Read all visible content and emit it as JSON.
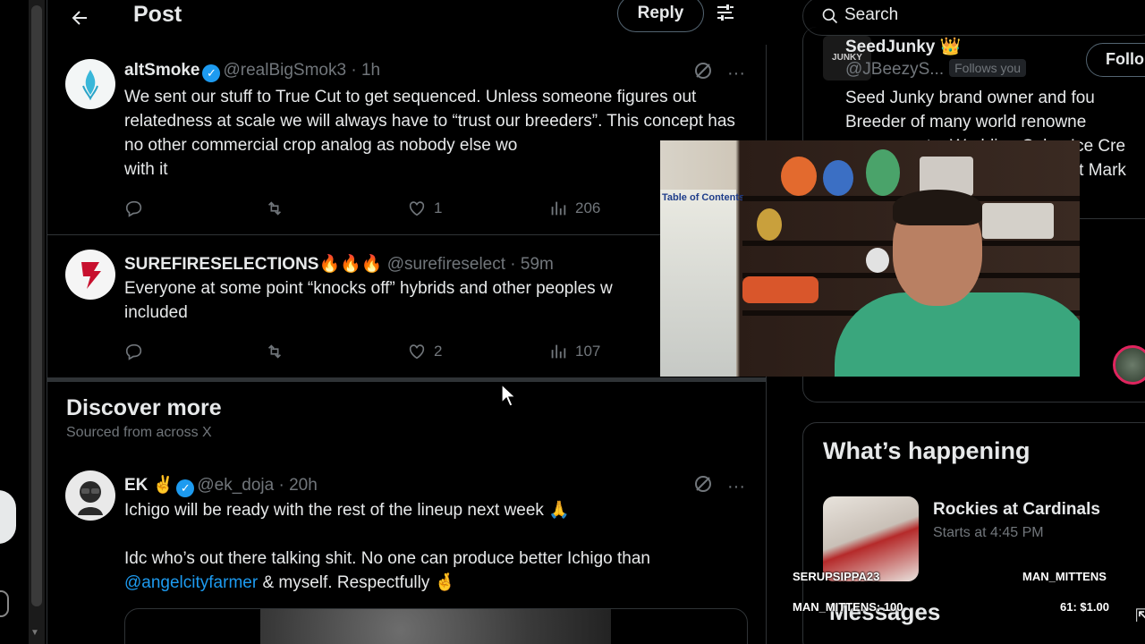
{
  "header": {
    "back_icon": "arrow-left-icon",
    "title": "Post",
    "reply_button": "Reply",
    "filter_icon": "sliders-icon"
  },
  "posts": [
    {
      "name": "altSmoke",
      "verified": true,
      "handle": "@realBigSmok3",
      "time": "· 1h",
      "text": "We sent our stuff to True Cut to get sequenced. Unless someone figures out relatedness at scale we will always have to “trust our breeders”. This concept has no other commercial crop analog as nobody else wo",
      "text_tail": "with it",
      "likes": "1",
      "views": "206"
    },
    {
      "name": "SUREFIRESELECTIONS🔥🔥🔥",
      "verified": false,
      "handle": "@surefireselect",
      "time": "· 59m",
      "text": "Everyone at some point “knocks off” hybrids and other peoples w",
      "text_tail": "included",
      "likes": "2",
      "views": "107"
    }
  ],
  "discover": {
    "title": "Discover more",
    "subtitle": "Sourced from across X"
  },
  "discover_post": {
    "name": "EK ✌️",
    "verified": true,
    "handle": "@ek_doja",
    "time": "· 20h",
    "line1": "Ichigo will be ready with the rest of the lineup next week 🙏",
    "line2_pre": "Idc who’s out there talking shit. No one can produce better Ichigo than",
    "mention": "@angelcityfarmer",
    "line2_post": " & myself. Respectfully 🤞"
  },
  "sidebar": {
    "search_placeholder": "Search",
    "suggested": {
      "avatar_text": "JUNKY",
      "name": "SeedJunky 👑",
      "handle": "@JBeezyS...",
      "follows_you": "Follows you",
      "follow_button": "Follo",
      "bio_lines": [
        "Seed Junky brand owner and fou",
        "Breeder of many world renowne",
        "ata, Wedding Cake, Ice Cre",
        "ent Mark"
      ]
    },
    "trends": {
      "title": "What’s happening",
      "item_name": "Rockies at Cardinals",
      "item_meta": "Starts at 4:45 PM"
    },
    "messages_title": "Messages"
  },
  "stream_overlay": {
    "user1": "SERUPSIPPA23",
    "user2": "MAN_MITTENS",
    "line1": "MAN_MITTENS: 100",
    "line2": "61: $1.00"
  },
  "webcam": {
    "poster_text": "Table of Contents"
  },
  "colors": {
    "accent": "#1d9bf0",
    "muted": "#71767b",
    "border": "#2f3336",
    "background": "#000000"
  }
}
